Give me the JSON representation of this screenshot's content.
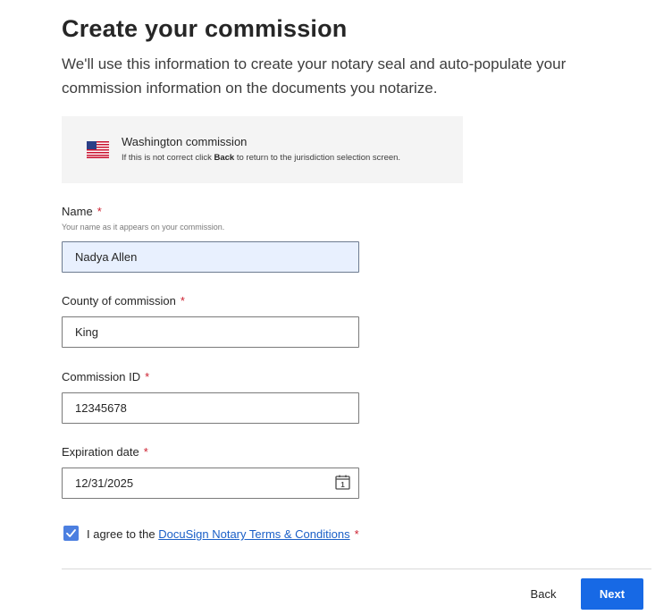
{
  "header": {
    "title": "Create your commission",
    "subtitle": "We'll use this information to create your notary seal and auto-populate your commission information on the documents you notarize."
  },
  "jurisdiction": {
    "flag_icon": "us-flag-icon",
    "title": "Washington commission",
    "hint_prefix": "If this is not correct click ",
    "hint_bold": "Back",
    "hint_suffix": " to return to the jurisdiction selection screen."
  },
  "form": {
    "required_marker": "*",
    "name": {
      "label": "Name",
      "help": "Your name as it appears on your commission.",
      "value": "Nadya Allen"
    },
    "county": {
      "label": "County of commission",
      "value": "King"
    },
    "commission_id": {
      "label": "Commission ID",
      "value": "12345678"
    },
    "expiration": {
      "label": "Expiration date",
      "value": "12/31/2025",
      "icon": "calendar-icon"
    }
  },
  "agreement": {
    "checked": true,
    "text_prefix": "I agree to the ",
    "link_text": "DocuSign Notary Terms & Conditions"
  },
  "footer": {
    "back_label": "Back",
    "next_label": "Next"
  },
  "colors": {
    "primary": "#1769e5",
    "required": "#cc1f2f",
    "link": "#1a5fc7",
    "autofill_bg": "#e8f0fe"
  }
}
